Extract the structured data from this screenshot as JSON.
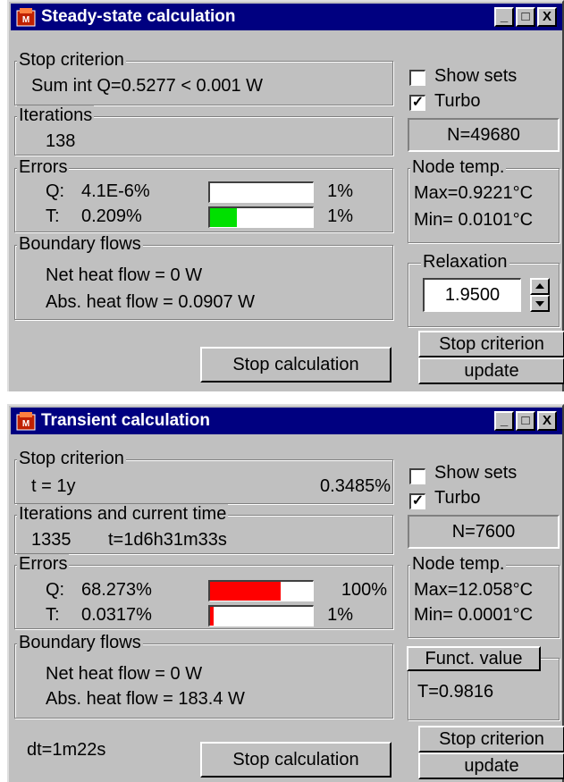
{
  "steady": {
    "title": "Steady-state calculation",
    "titlebar_buttons": [
      "_",
      "□",
      "X"
    ],
    "stop_criterion": {
      "legend": "Stop criterion",
      "text": "Sum int Q=0.5277 < 0.001 W"
    },
    "iterations": {
      "legend": "Iterations",
      "value": "138"
    },
    "errors": {
      "legend": "Errors",
      "q_label": "Q:",
      "q_value": "4.1E-6%",
      "q_limit": "1%",
      "q_fill_fraction": 0.0,
      "t_label": "T:",
      "t_value": "0.209%",
      "t_limit": "1%",
      "t_fill_fraction": 0.209,
      "t_fill_color": "#00e000",
      "q_fill_color": "#00e000"
    },
    "boundary": {
      "legend": "Boundary flows",
      "net": "Net heat flow =   0 W",
      "abs": "Abs. heat flow = 0.0907 W"
    },
    "show_sets": {
      "label": "Show sets",
      "checked": false,
      "mark": ""
    },
    "turbo": {
      "label": "Turbo",
      "checked": true,
      "mark": "✓"
    },
    "n_value": "N=49680",
    "node_temp": {
      "legend": "Node temp.",
      "max": "Max=0.9221°C",
      "min": "Min= 0.0101°C"
    },
    "relaxation": {
      "legend": "Relaxation",
      "value": "1.9500"
    },
    "stop_button": "Stop calculation",
    "criterion_button": "Stop criterion",
    "update_button": "update"
  },
  "transient": {
    "title": "Transient calculation",
    "titlebar_buttons": [
      "_",
      "□",
      "X"
    ],
    "stop_criterion": {
      "legend": "Stop criterion",
      "text": "t = 1y",
      "percent": "0.3485%"
    },
    "iterations": {
      "legend": "Iterations and current time",
      "value": "1335",
      "time": "t=1d6h31m33s"
    },
    "errors": {
      "legend": "Errors",
      "q_label": "Q:",
      "q_value": "68.273%",
      "q_limit": "100%",
      "q_fill_fraction": 0.68273,
      "t_label": "T:",
      "t_value": "0.0317%",
      "t_limit": "1%",
      "t_fill_fraction": 0.0317,
      "q_fill_color": "#ff0000",
      "t_fill_color": "#ff0000"
    },
    "boundary": {
      "legend": "Boundary flows",
      "net": "Net heat flow =   0 W",
      "abs": "Abs. heat flow = 183.4 W"
    },
    "show_sets": {
      "label": "Show sets",
      "checked": false,
      "mark": ""
    },
    "turbo": {
      "label": "Turbo",
      "checked": true,
      "mark": "✓"
    },
    "n_value": "N=7600",
    "node_temp": {
      "legend": "Node temp.",
      "max": "Max=12.058°C",
      "min": "Min= 0.0001°C"
    },
    "funct_button": "Funct. value",
    "funct_value": "T=0.9816",
    "dt": "dt=1m22s",
    "stop_button": "Stop calculation",
    "criterion_button": "Stop criterion",
    "update_button": "update"
  }
}
